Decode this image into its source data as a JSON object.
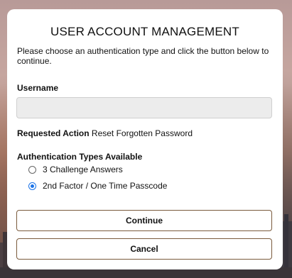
{
  "card": {
    "title": "USER ACCOUNT MANAGEMENT",
    "instructions": "Please choose an authentication type and click the button below to continue."
  },
  "username": {
    "label": "Username",
    "value": "",
    "placeholder": ""
  },
  "requested_action": {
    "label": "Requested Action",
    "value": "Reset Forgotten Password"
  },
  "auth_types": {
    "label": "Authentication Types Available",
    "options": [
      {
        "label": "3 Challenge Answers",
        "selected": false
      },
      {
        "label": "2nd Factor / One Time Passcode",
        "selected": true
      }
    ]
  },
  "buttons": {
    "continue": "Continue",
    "cancel": "Cancel"
  },
  "colors": {
    "accent_radio": "#1a73e8",
    "button_border": "#7a5a3c",
    "input_bg": "#ececec"
  }
}
